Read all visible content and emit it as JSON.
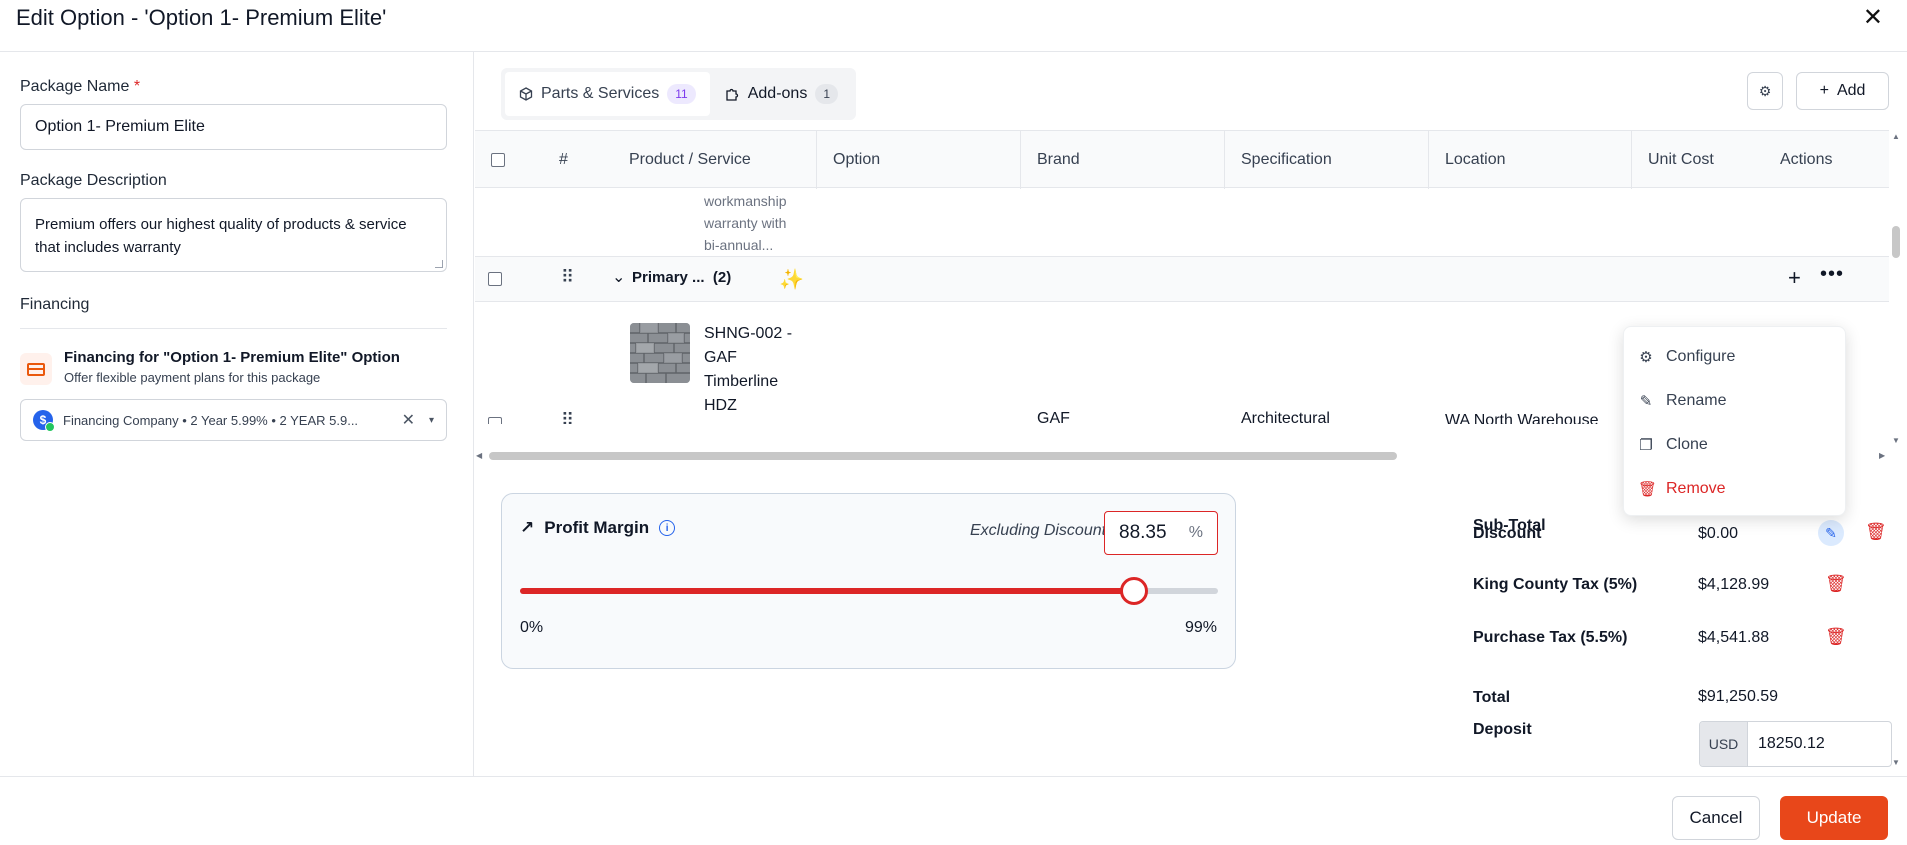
{
  "dialog": {
    "title": "Edit Option - 'Option 1- Premium Elite'",
    "close_icon": "✕"
  },
  "left": {
    "package_name_label": "Package Name",
    "required_mark": "*",
    "package_name_value": "Option 1- Premium Elite",
    "package_description_label": "Package Description",
    "package_description_value": "Premium offers our highest quality of products & service that includes warranty",
    "financing_label": "Financing",
    "financing_title": "Financing for \"Option 1- Premium Elite\" Option",
    "financing_subtitle": "Offer flexible payment plans for this package",
    "financing_selected": "Financing Company • 2 Year 5.99% • 2 YEAR 5.9...",
    "financing_logo_glyph": "$",
    "financing_clear_glyph": "✕",
    "financing_chevron_glyph": "▾"
  },
  "tabs": [
    {
      "label": "Parts & Services",
      "count": "11",
      "icon": "cube-icon"
    },
    {
      "label": "Add-ons",
      "count": "1",
      "icon": "puzzle-icon"
    }
  ],
  "toolbar": {
    "gear_glyph": "⚙",
    "add_label": "Add",
    "add_glyph": "+"
  },
  "table": {
    "columns": [
      "#",
      "Product / Service",
      "Option",
      "Brand",
      "Specification",
      "Location",
      "Unit Cost",
      "Actions"
    ],
    "description_lines": [
      "workmanship",
      "warranty with",
      "bi-annual..."
    ],
    "group": {
      "label": "Primary ...",
      "count": "(2)",
      "sparkle_glyph": "✨",
      "chevron_glyph": "⌄",
      "add_glyph": "+",
      "more_glyph": "•••"
    },
    "product_row": {
      "name_lines": [
        "SHNG-002 -",
        "GAF",
        "Timberline",
        "HDZ"
      ],
      "option": "-",
      "brand": "GAF",
      "specification": "Architectural",
      "location": "WA North Warehouse"
    },
    "drag_glyph": "⠿"
  },
  "menu": {
    "items": [
      {
        "label": "Configure",
        "icon": "gear-icon",
        "glyph": "⚙"
      },
      {
        "label": "Rename",
        "icon": "edit-icon",
        "glyph": "✎"
      },
      {
        "label": "Clone",
        "icon": "copy-icon",
        "glyph": "❐"
      },
      {
        "label": "Remove",
        "icon": "trash-icon",
        "glyph": "🗑"
      }
    ]
  },
  "profit_margin": {
    "title": "Profit Margin",
    "trend_glyph": "↗",
    "info_glyph": "i",
    "mode_label": "Excluding Discount",
    "value": "88.35",
    "unit": "%",
    "min_label": "0%",
    "max_label": "99%",
    "slider_fraction": 0.8795
  },
  "totals": {
    "subtotal_label": "Sub-Total",
    "discount_label": "Discount",
    "discount_value": "$0.00",
    "tax1_label": "King County Tax (5%)",
    "tax1_value": "$4,128.99",
    "tax2_label": "Purchase Tax (5.5%)",
    "tax2_value": "$4,541.88",
    "total_label": "Total",
    "total_value": "$91,250.59",
    "deposit_label": "Deposit",
    "deposit_currency": "USD",
    "deposit_value": "18250.12",
    "pencil_glyph": "✎",
    "trash_glyph": "🗑"
  },
  "footer": {
    "cancel_label": "Cancel",
    "update_label": "Update"
  },
  "colors": {
    "accent": "#e8471a",
    "danger": "#dc2626",
    "link": "#2563eb"
  }
}
